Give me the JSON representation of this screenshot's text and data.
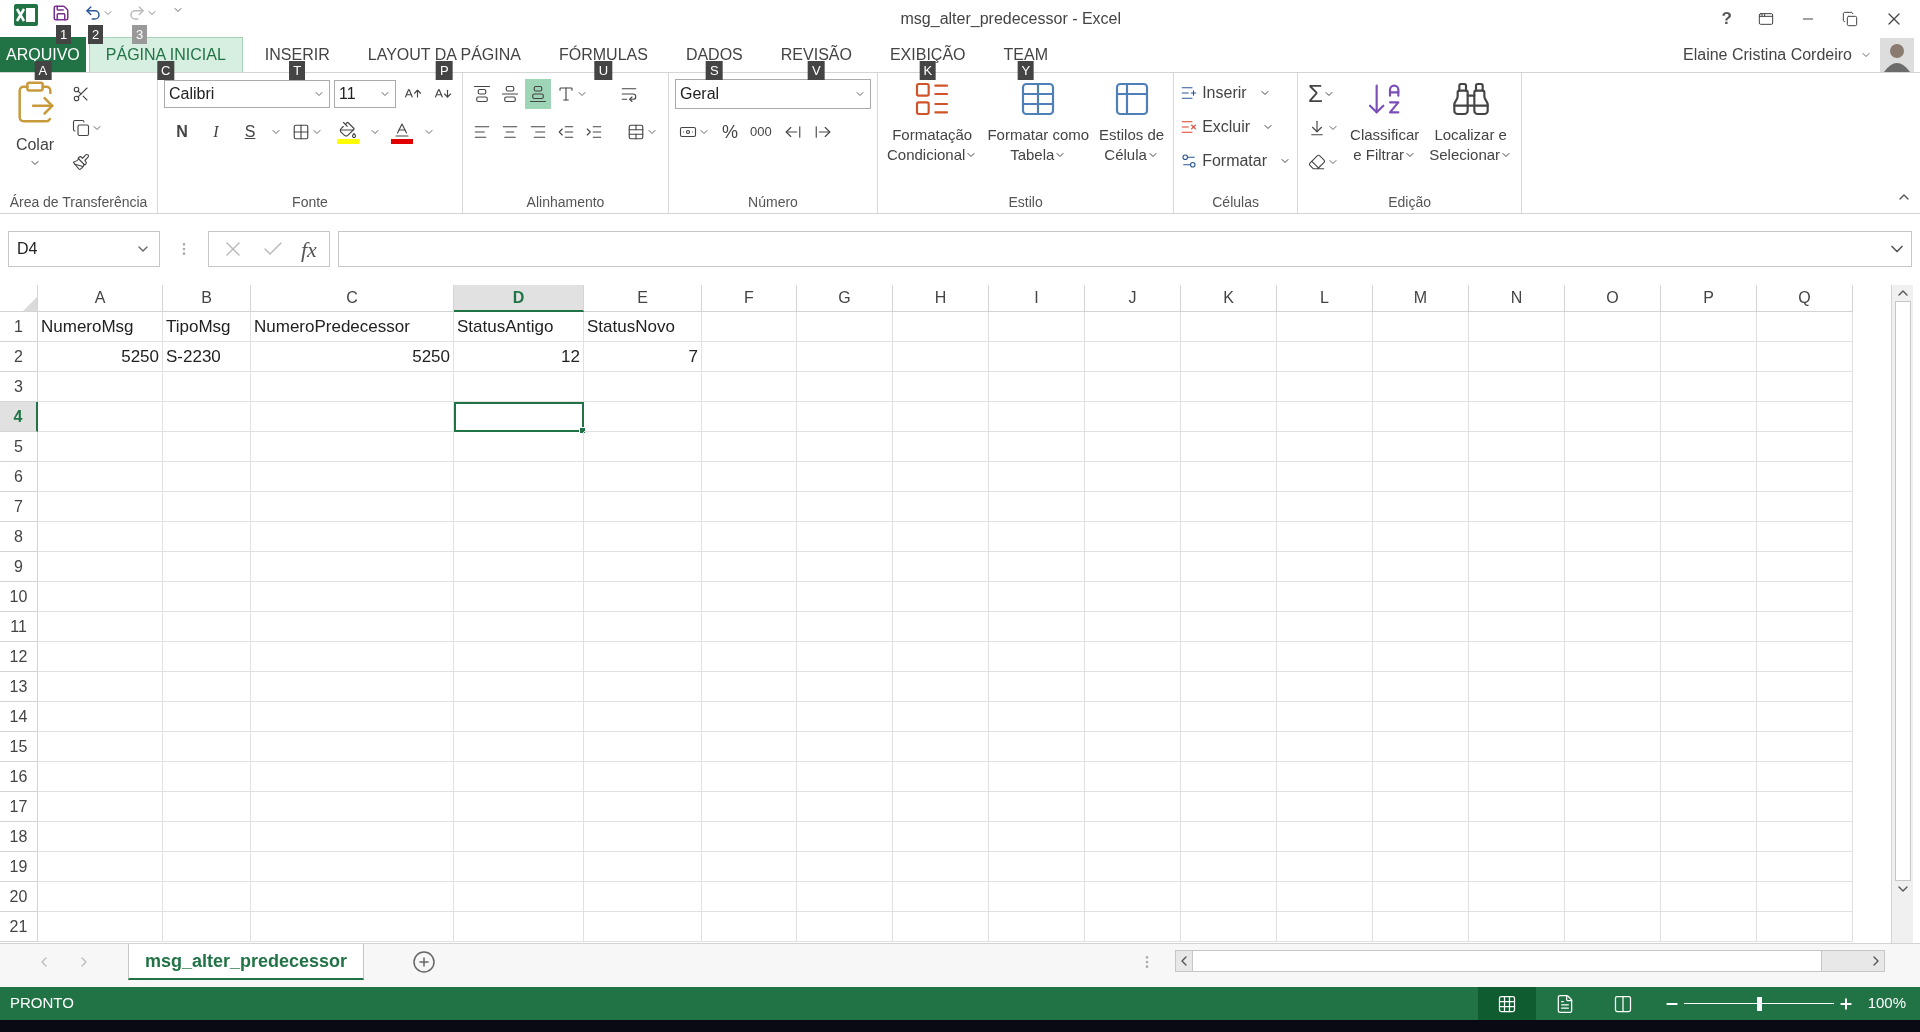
{
  "title_bar": {
    "title": "msg_alter_predecessor - Excel",
    "help": "?",
    "quick_access": [
      {
        "keytip": "1",
        "disabled": false
      },
      {
        "keytip": "2",
        "disabled": false
      },
      {
        "keytip": "3",
        "disabled": true
      }
    ]
  },
  "ribbon_tabs": [
    {
      "label": "ARQUIVO",
      "kind": "file",
      "keytip": "A",
      "selected": false
    },
    {
      "label": "PÁGINA INICIAL",
      "kind": "tab",
      "keytip": "C",
      "selected": true
    },
    {
      "label": "INSERIR",
      "kind": "tab",
      "keytip": "T",
      "selected": false
    },
    {
      "label": "LAYOUT DA PÁGINA",
      "kind": "tab",
      "keytip": "P",
      "selected": false
    },
    {
      "label": "FÓRMULAS",
      "kind": "tab",
      "keytip": "U",
      "selected": false
    },
    {
      "label": "DADOS",
      "kind": "tab",
      "keytip": "S",
      "selected": false
    },
    {
      "label": "REVISÃO",
      "kind": "tab",
      "keytip": "V",
      "selected": false
    },
    {
      "label": "EXIBIÇÃO",
      "kind": "tab",
      "keytip": "K",
      "selected": false
    },
    {
      "label": "TEAM",
      "kind": "tab",
      "keytip": "Y",
      "selected": false
    }
  ],
  "user": {
    "name": "Elaine Cristina Cordeiro"
  },
  "ribbon": {
    "clipboard": {
      "label": "Área de Transferência",
      "paste": "Colar"
    },
    "font": {
      "label": "Fonte",
      "font_name": "Calibri",
      "font_size": "11",
      "bold": "N",
      "italic": "I",
      "underline": "S"
    },
    "alignment": {
      "label": "Alinhamento",
      "vertical_align": [
        {
          "selected": false
        },
        {
          "selected": false
        },
        {
          "selected": true
        }
      ]
    },
    "number": {
      "label": "Número",
      "format": "Geral",
      "percent": "%",
      "thousands": "000"
    },
    "styles": {
      "label": "Estilo",
      "buttons": [
        {
          "lines": [
            "Formatação",
            "Condicional"
          ]
        },
        {
          "lines": [
            "Formatar como",
            "Tabela"
          ]
        },
        {
          "lines": [
            "Estilos de",
            "Célula"
          ]
        }
      ]
    },
    "cells": {
      "label": "Células",
      "items": [
        "Inserir",
        "Excluir",
        "Formatar"
      ]
    },
    "editing": {
      "label": "Edição",
      "autosum": "Σ",
      "buttons": [
        {
          "lines": [
            "Classificar",
            "e Filtrar"
          ]
        },
        {
          "lines": [
            "Localizar e",
            "Selecionar"
          ]
        }
      ]
    }
  },
  "formula_bar": {
    "name_box": "D4",
    "fx": "fx"
  },
  "columns": [
    {
      "label": "A",
      "selected": false
    },
    {
      "label": "B",
      "selected": false
    },
    {
      "label": "C",
      "selected": false
    },
    {
      "label": "D",
      "selected": true
    },
    {
      "label": "E",
      "selected": false
    },
    {
      "label": "F",
      "selected": false
    },
    {
      "label": "G",
      "selected": false
    },
    {
      "label": "H",
      "selected": false
    },
    {
      "label": "I",
      "selected": false
    },
    {
      "label": "J",
      "selected": false
    },
    {
      "label": "K",
      "selected": false
    },
    {
      "label": "L",
      "selected": false
    },
    {
      "label": "M",
      "selected": false
    },
    {
      "label": "N",
      "selected": false
    },
    {
      "label": "O",
      "selected": false
    },
    {
      "label": "P",
      "selected": false
    },
    {
      "label": "Q",
      "selected": false
    }
  ],
  "rows": [
    {
      "number": "1",
      "selected": false,
      "cells": [
        {
          "text": "NumeroMsg",
          "kind": "text"
        },
        {
          "text": "TipoMsg",
          "kind": "text"
        },
        {
          "text": "NumeroPredecessor",
          "kind": "text"
        },
        {
          "text": "StatusAntigo",
          "kind": "text"
        },
        {
          "text": "StatusNovo",
          "kind": "text"
        }
      ]
    },
    {
      "number": "2",
      "selected": false,
      "cells": [
        {
          "text": "5250",
          "kind": "number"
        },
        {
          "text": "S-2230",
          "kind": "text"
        },
        {
          "text": "5250",
          "kind": "number"
        },
        {
          "text": "12",
          "kind": "number"
        },
        {
          "text": "7",
          "kind": "number"
        }
      ]
    },
    {
      "number": "3",
      "selected": false
    },
    {
      "number": "4",
      "selected": true
    },
    {
      "number": "5",
      "selected": false
    },
    {
      "number": "6",
      "selected": false
    },
    {
      "number": "7",
      "selected": false
    },
    {
      "number": "8",
      "selected": false
    },
    {
      "number": "9",
      "selected": false
    },
    {
      "number": "10",
      "selected": false
    },
    {
      "number": "11",
      "selected": false
    },
    {
      "number": "12",
      "selected": false
    },
    {
      "number": "13",
      "selected": false
    },
    {
      "number": "14",
      "selected": false
    },
    {
      "number": "15",
      "selected": false
    },
    {
      "number": "16",
      "selected": false
    },
    {
      "number": "17",
      "selected": false
    },
    {
      "number": "18",
      "selected": false
    },
    {
      "number": "19",
      "selected": false
    },
    {
      "number": "20",
      "selected": false
    },
    {
      "number": "21",
      "selected": false
    }
  ],
  "sheet_tabs": [
    {
      "label": "msg_alter_predecessor",
      "selected": true
    }
  ],
  "status_bar": {
    "status": "PRONTO",
    "views": [
      {
        "selected": true
      },
      {
        "selected": false
      },
      {
        "selected": false
      }
    ],
    "zoom": "100%",
    "zoom_slider": {
      "level": 0.5
    }
  }
}
